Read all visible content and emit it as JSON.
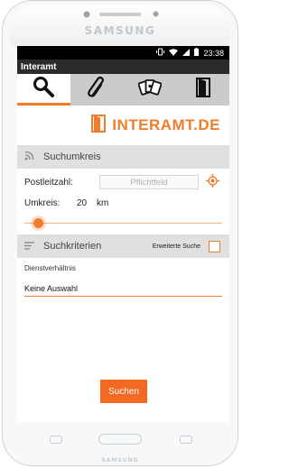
{
  "device": {
    "brand": "SAMSUNG",
    "bottom_brand": "SAMSUNG"
  },
  "status_bar": {
    "time": "23:38",
    "icons": [
      "vibrate-icon",
      "wifi-icon",
      "signal-icon",
      "battery-icon"
    ]
  },
  "app": {
    "title": "Interamt"
  },
  "tabs": [
    {
      "icon": "search-icon",
      "active": true
    },
    {
      "icon": "paperclip-icon",
      "active": false
    },
    {
      "icon": "cards-icon",
      "active": false
    },
    {
      "icon": "door-exit-icon",
      "active": false
    }
  ],
  "logo": {
    "text": "INTERAMT.DE"
  },
  "suchumkreis": {
    "title": "Suchumkreis",
    "postcode_label": "Postleitzahl:",
    "postcode_placeholder": "Pflichtfeld",
    "radius_label": "Umkreis:",
    "radius_value": "20",
    "radius_unit": "km",
    "slider_fraction": 0.07
  },
  "suchkriterien": {
    "title": "Suchkriterien",
    "extended_label": "Erweiterte Suche",
    "extended_checked": false,
    "field_label": "Dienstverhältnis",
    "field_value": "Keine Auswahl"
  },
  "search_button": {
    "label": "Suchen"
  },
  "colors": {
    "accent": "#f07d2b",
    "section_bg": "#e0e0e0",
    "tab_bg": "#cbcbcb"
  }
}
